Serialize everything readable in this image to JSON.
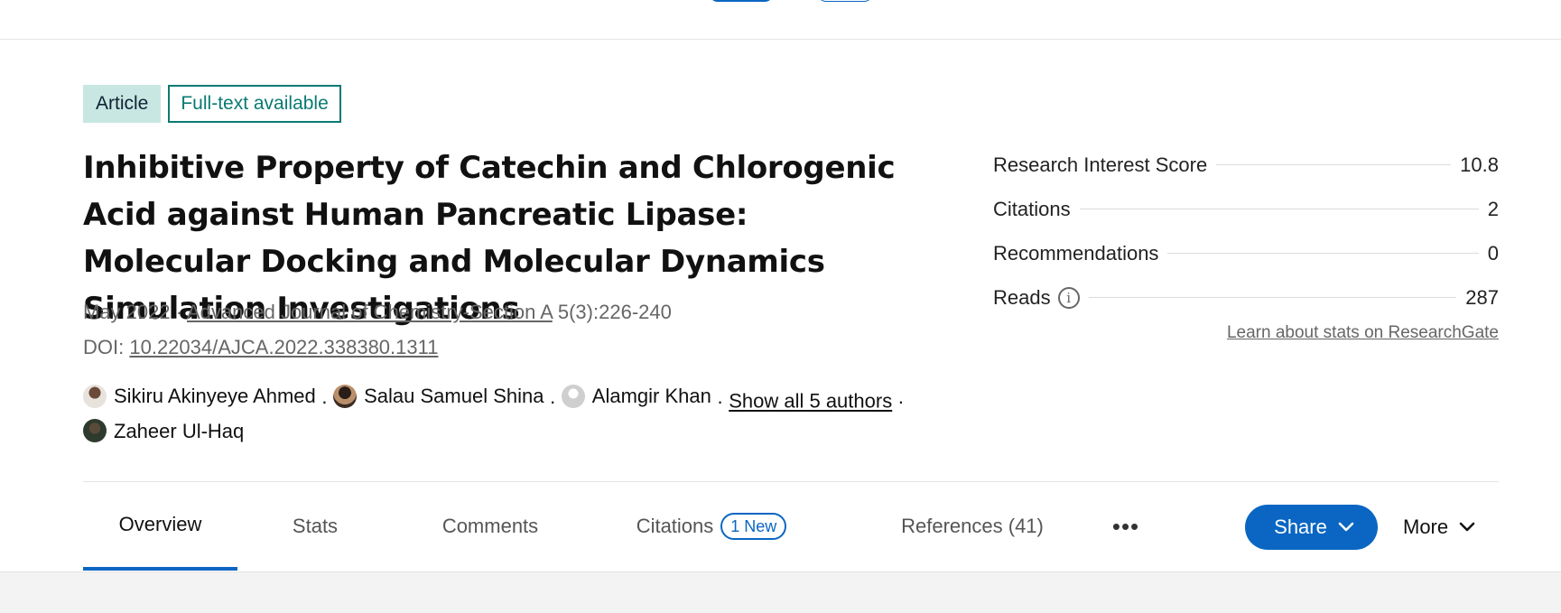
{
  "publication": {
    "type_badge": "Article",
    "availability_badge": "Full-text available",
    "title": "Inhibitive Property of Catechin and Chlorogenic Acid against Human Pancreatic Lipase: Molecular Docking and Molecular Dynamics Simulation Investigations",
    "date": "May 2022",
    "journal": "Advanced Journal of Chemistry-Section A",
    "volume_pages": "5(3):226-240",
    "doi_label": "DOI:",
    "doi": "10.22034/AJCA.2022.338380.1311"
  },
  "authors": {
    "list": [
      {
        "name": "Sikiru Akinyeye Ahmed"
      },
      {
        "name": "Salau Samuel Shina"
      },
      {
        "name": "Alamgir Khan"
      },
      {
        "name": "Zaheer Ul-Haq"
      }
    ],
    "show_all": "Show all 5 authors",
    "separator": "·"
  },
  "stats": {
    "rows": [
      {
        "label": "Research Interest Score",
        "value": "10.8"
      },
      {
        "label": "Citations",
        "value": "2"
      },
      {
        "label": "Recommendations",
        "value": "0"
      },
      {
        "label": "Reads",
        "value": "287",
        "icon": "info-icon"
      }
    ],
    "learn_link": "Learn about stats on ResearchGate"
  },
  "tabs": {
    "overview": "Overview",
    "stats": "Stats",
    "comments": "Comments",
    "citations": "Citations",
    "citations_badge": "1 New",
    "references": "References (41)",
    "more_dots": "•••",
    "share": "Share",
    "more": "More"
  },
  "colors": {
    "accent": "#0a66c2",
    "badge_bg": "#c8e7e3",
    "fulltext": "#0a7a73"
  }
}
